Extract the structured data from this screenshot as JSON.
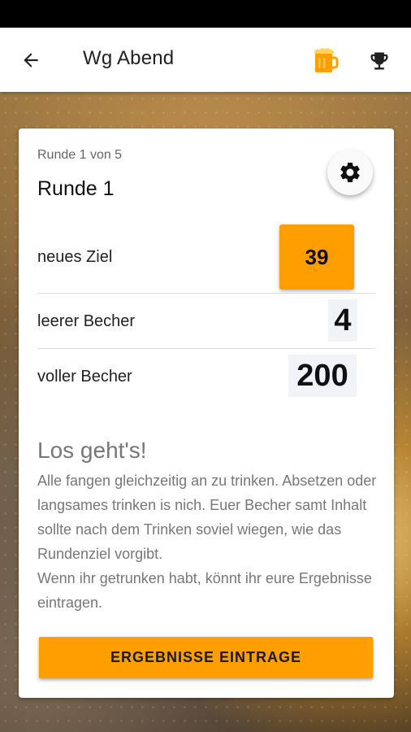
{
  "app_bar": {
    "title": "Wg Abend",
    "back_icon": "arrow-back-icon",
    "beer_icon": "beer-mug-icon",
    "trophy_icon": "trophy-icon"
  },
  "round": {
    "counter": "Runde 1 von 5",
    "title": "Runde 1"
  },
  "rows": {
    "target_label": "neues Ziel",
    "target_value": "39",
    "empty_label": "leerer Becher",
    "empty_value": "4",
    "full_label": "voller Becher",
    "full_value": "200"
  },
  "intro": {
    "title": "Los geht's!",
    "text": "Alle fangen gleichzeitig an zu trinken. Absetzen oder langsames trinken is nich. Euer Becher samt Inhalt sollte nach dem Trinken soviel wiegen, wie das Rundenziel vorgibt.\nWenn ihr getrunken habt, könnt ihr eure Ergebnisse eintragen."
  },
  "submit_label": "ERGEBNISSE EINTRAGE",
  "colors": {
    "accent": "#ff9e00",
    "surface": "#ffffff",
    "value_box": "#f1f3f6"
  }
}
